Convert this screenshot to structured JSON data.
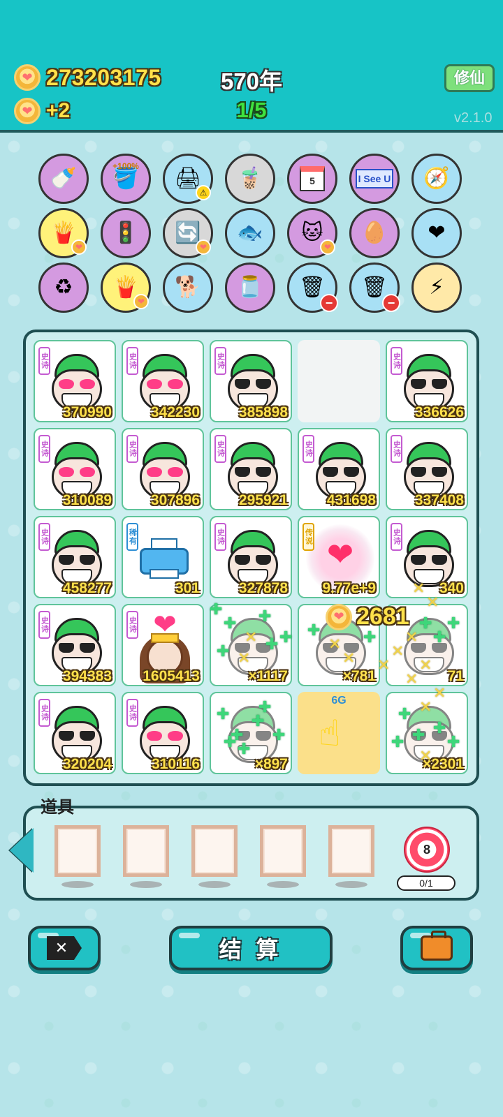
{
  "header": {
    "coins": "273203175",
    "coin_rate": "+2",
    "years": "570年",
    "stage": "1/5",
    "xiuxian_label": "修仙",
    "version": "v2.1.0"
  },
  "items": [
    {
      "name": "breast-pump-icon",
      "bg": "#d49ae0",
      "glyph": "🍼"
    },
    {
      "name": "bucket-icon",
      "bg": "#d49ae0",
      "glyph": "🪣",
      "label": "+100%"
    },
    {
      "name": "printer-icon",
      "bg": "#a8e0f5",
      "glyph": "🖨",
      "warn": true
    },
    {
      "name": "bubble-tea-icon",
      "bg": "#d8d8d8",
      "glyph": "🧋"
    },
    {
      "name": "calendar-icon",
      "bg": "#d49ae0",
      "calendar": "5"
    },
    {
      "name": "i-see-u-icon",
      "bg": "#d49ae0",
      "isu": "I See U"
    },
    {
      "name": "compass-icon",
      "bg": "#a8e0f5",
      "glyph": "🧭"
    },
    {
      "name": "fries-icon",
      "bg": "#fff27a",
      "glyph": "🍟",
      "heart": true
    },
    {
      "name": "ghost-traffic-light-icon",
      "bg": "#d49ae0",
      "glyph": "🚦"
    },
    {
      "name": "refresh-icon",
      "bg": "#d8d8d8",
      "glyph": "🔄",
      "heart": true
    },
    {
      "name": "fish-tank-icon",
      "bg": "#a8e0f5",
      "glyph": "🐟"
    },
    {
      "name": "cat-icon",
      "bg": "#d49ae0",
      "glyph": "🐱",
      "heart": true
    },
    {
      "name": "egg-icon",
      "bg": "#d49ae0",
      "glyph": "🥚"
    },
    {
      "name": "heart-fan-icon",
      "bg": "#a8e0f5",
      "glyph": "❤"
    },
    {
      "name": "recycle-icon",
      "bg": "#d49ae0",
      "glyph": "♻"
    },
    {
      "name": "fries-icon",
      "bg": "#fff27a",
      "glyph": "🍟",
      "heart": true
    },
    {
      "name": "shiba-dog-icon",
      "bg": "#a8e0f5",
      "glyph": "🐕"
    },
    {
      "name": "jar-icon",
      "bg": "#d49ae0",
      "glyph": "🫙"
    },
    {
      "name": "trash-bag-icon",
      "bg": "#a8e0f5",
      "glyph": "🗑",
      "minus": true
    },
    {
      "name": "trash-bag-icon",
      "bg": "#a8e0f5",
      "glyph": "🗑",
      "minus": true
    },
    {
      "name": "lightning-icon",
      "bg": "#ffe9a8",
      "glyph": "⚡"
    }
  ],
  "board": [
    {
      "type": "face",
      "tag": "史诗",
      "glasses": "heart",
      "value": "370990"
    },
    {
      "type": "face",
      "tag": "史诗",
      "glasses": "heart",
      "value": "342230"
    },
    {
      "type": "face",
      "tag": "史诗",
      "glasses": "dark",
      "value": "385898"
    },
    {
      "type": "empty"
    },
    {
      "type": "face",
      "tag": "史诗",
      "glasses": "dark",
      "value": "336626"
    },
    {
      "type": "face",
      "tag": "史诗",
      "glasses": "heart",
      "value": "310089"
    },
    {
      "type": "face",
      "tag": "史诗",
      "glasses": "heart",
      "value": "307896"
    },
    {
      "type": "face",
      "tag": "史诗",
      "glasses": "dark",
      "value": "295921"
    },
    {
      "type": "face",
      "tag": "史诗",
      "glasses": "dark",
      "value": "431698"
    },
    {
      "type": "face",
      "tag": "史诗",
      "glasses": "dark",
      "value": "337408"
    },
    {
      "type": "face",
      "tag": "史诗",
      "glasses": "dark",
      "value": "458277"
    },
    {
      "type": "printer",
      "tag": "稀有",
      "value": "301"
    },
    {
      "type": "face",
      "tag": "史诗",
      "glasses": "dark",
      "value": "327878"
    },
    {
      "type": "legend",
      "tag": "传说",
      "value": "9.77e+9"
    },
    {
      "type": "face",
      "tag": "史诗",
      "glasses": "dark",
      "value": "340"
    },
    {
      "type": "face",
      "tag": "史诗",
      "glasses": "dark",
      "value": "394383"
    },
    {
      "type": "fairy",
      "tag": "史诗",
      "value": "1605413"
    },
    {
      "type": "sparkle",
      "value": "×1117"
    },
    {
      "type": "sparkle",
      "value": "×781"
    },
    {
      "type": "sparkle",
      "value": "71"
    },
    {
      "type": "face",
      "tag": "史诗",
      "glasses": "dark",
      "value": "320204"
    },
    {
      "type": "face",
      "tag": "史诗",
      "glasses": "heart",
      "value": "310116"
    },
    {
      "type": "sparkle",
      "value": "×897"
    },
    {
      "type": "hand",
      "label": "6G"
    },
    {
      "type": "sparkle",
      "value": "×2301"
    }
  ],
  "floating_coin": "2681",
  "props": {
    "label": "道具",
    "target_number": "8",
    "target_count": "0/1"
  },
  "bottom": {
    "settle_label": "结 算"
  }
}
